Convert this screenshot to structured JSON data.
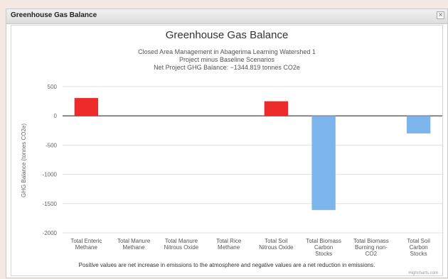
{
  "window": {
    "title": "Greenhouse Gas Balance",
    "close_label": "×"
  },
  "chart_data": {
    "type": "bar",
    "title": "Greenhouse Gas Balance",
    "subtitle": [
      "Closed Area Management in Abagerima Learning Watershed 1",
      "Project minus Baseline Scenarios",
      "Net Project GHG Balance: −1344.819 tonnes CO2e"
    ],
    "xlabel": "",
    "ylabel": "GHG Balance (tonnes CO2e)",
    "ylim": [
      -2000,
      500
    ],
    "yticks": [
      500,
      0,
      -500,
      -1000,
      -1500,
      -2000
    ],
    "categories": [
      [
        "Total Enteric",
        "Methane"
      ],
      [
        "Total Manure",
        "Methane"
      ],
      [
        "Total Manure",
        "Nitrous Oxide"
      ],
      [
        "Total Rice",
        "Methane"
      ],
      [
        "Total Soil",
        "Nitrous Oxide"
      ],
      [
        "Total Biomass",
        "Carbon",
        "Stocks"
      ],
      [
        "Total Biomass",
        "Burning non-",
        "CO2"
      ],
      [
        "Total Soil",
        "Carbon",
        "Stocks"
      ]
    ],
    "values": [
      305,
      0,
      0,
      0,
      250,
      -1610,
      0,
      -300
    ],
    "colors": {
      "positive": "#ee2b2b",
      "negative": "#7cb5ec"
    },
    "gridlines": true,
    "footnote": "Positive values are net increase in emissions to the atmosphere and negative values are a net reduction in emissions.",
    "credit": "Highcharts.com"
  }
}
